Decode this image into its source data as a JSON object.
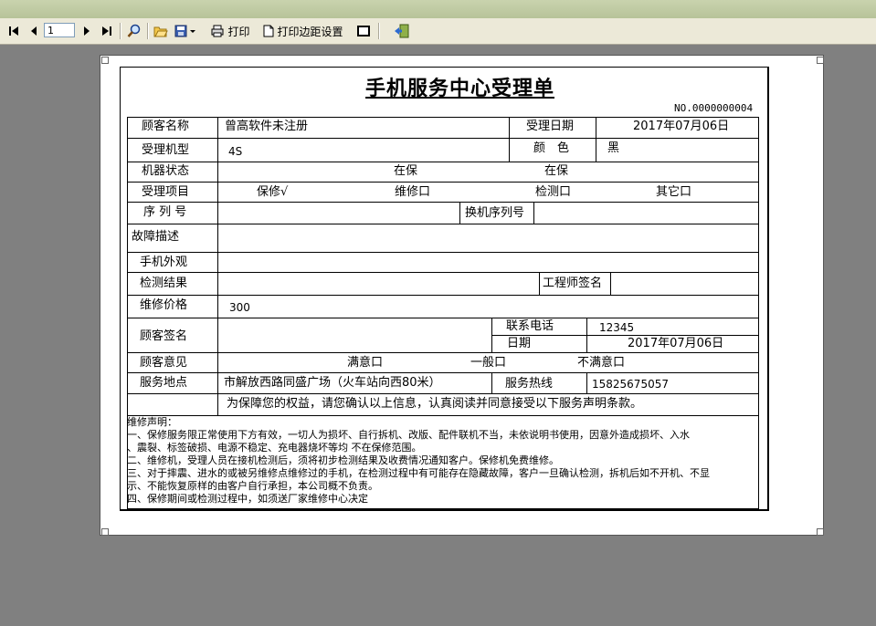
{
  "toolbar": {
    "page_number": "1",
    "print_label": "打印",
    "margin_label": "打印边距设置"
  },
  "form": {
    "title": "手机服务中心受理单",
    "serial": "NO.0000000004",
    "customer_name_label": "顾客名称",
    "customer_name_value": "曾高软件未注册",
    "accept_date_label": "受理日期",
    "accept_date_value": "2017年07月06日",
    "model_label": "受理机型",
    "model_value": "4S",
    "color_label": "颜　色",
    "color_value": "黑",
    "state_label": "机器状态",
    "state_value_1": "在保",
    "state_value_2": "在保",
    "item_label": "受理项目",
    "item_warranty": "保修√",
    "item_repair": "维修口",
    "item_inspect": "检测口",
    "item_other": "其它口",
    "serial_label": "序 列 号",
    "swap_serial_label": "换机序列号",
    "fault_label": "故障描述",
    "appearance_label": "手机外观",
    "result_label": "检测结果",
    "engineer_label": "工程师签名",
    "price_label": "维修价格",
    "price_value": "300",
    "signature_label": "顾客签名",
    "phone_label": "联系电话",
    "phone_value": "12345",
    "date_label": "日期",
    "date_value": "2017年07月06日",
    "opinion_label": "顾客意见",
    "opinion_satisfied": "满意口",
    "opinion_normal": "一般口",
    "opinion_unsatisfied": "不满意口",
    "location_label": "服务地点",
    "location_value": "市解放西路同盛广场（火车站向西80米）",
    "hotline_label": "服务热线",
    "hotline_value": "15825675057",
    "confirm_text": "为保障您的权益，请您确认以上信息，认真阅读并同意接受以下服务声明条款。"
  },
  "notes": {
    "heading": "维修声明：",
    "line1": "一、保修服务限正常使用下方有效，一切人为损坏、自行拆机、改版、配件联机不当，未依说明书使用，因意外造成损坏、入水",
    "line2": "、震裂、标签破损、电源不稳定、充电器烧坏等均 不在保修范围。",
    "line3": "二、维修机，受理人员在接机检测后，须将初步检测结果及收费情况通知客户。保修机免费维修。",
    "line4": "三、对于摔震、进水的或被另维修点维修过的手机，在检测过程中有可能存在隐藏故障，客户一旦确认检测，拆机后如不开机、不显",
    "line5": "示、不能恢复原样的由客户自行承担，本公司概不负责。",
    "line6": "四、保修期间或检测过程中，如须送厂家维修中心决定"
  }
}
